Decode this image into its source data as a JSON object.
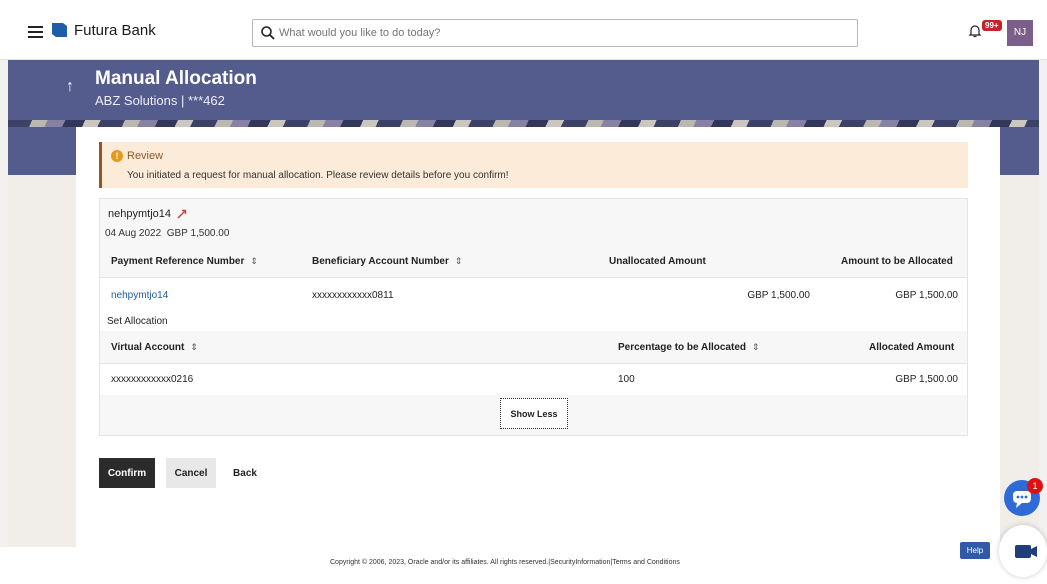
{
  "app": {
    "brand": "Futura Bank"
  },
  "search": {
    "placeholder": "What would you like to do today?"
  },
  "notifications": {
    "count": "99+"
  },
  "user": {
    "initials": "NJ"
  },
  "header": {
    "title": "Manual Allocation",
    "subtitle": "ABZ Solutions | ***462"
  },
  "review": {
    "title": "Review",
    "message": "You initiated a request for manual allocation. Please review details before you confirm!"
  },
  "transaction": {
    "reference": "nehpymtjo14",
    "date": "04 Aug 2022",
    "amount": "GBP 1,500.00"
  },
  "payment_table": {
    "headers": [
      "Payment Reference Number",
      "Beneficiary Account Number",
      "Unallocated Amount",
      "Amount to be Allocated"
    ],
    "rows": [
      {
        "payment_ref": "nehpymtjo14",
        "beneficiary_account": "xxxxxxxxxxxx0811",
        "unallocated": "GBP 1,500.00",
        "to_allocate": "GBP 1,500.00"
      }
    ]
  },
  "allocation": {
    "section_label": "Set Allocation",
    "headers": [
      "Virtual Account",
      "Percentage to be Allocated",
      "Allocated Amount"
    ],
    "rows": [
      {
        "virtual_account": "xxxxxxxxxxxx0216",
        "percentage": "100",
        "allocated_amount": "GBP 1,500.00"
      }
    ]
  },
  "buttons": {
    "show_less": "Show Less",
    "confirm": "Confirm",
    "cancel": "Cancel",
    "back": "Back"
  },
  "footer": {
    "text": "Copyright © 2006, 2023, Oracle and/or its affiliates. All rights reserved.|SecurityInformation|Terms and Conditions"
  },
  "chat": {
    "count": "1"
  },
  "help": {
    "label": "Help"
  },
  "colors": {
    "banner": "#535c8c",
    "link": "#1f5c99",
    "review_bg": "#fcebd8",
    "primary_button": "#2b2b2b"
  }
}
